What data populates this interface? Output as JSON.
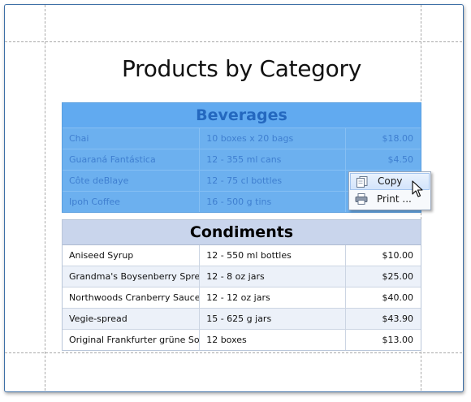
{
  "report": {
    "title": "Products by Category",
    "groups": [
      {
        "name": "Beverages",
        "selected": true,
        "rows": [
          {
            "product": "Chai",
            "quantity": "10 boxes x 20 bags",
            "price": "$18.00"
          },
          {
            "product": "Guaraná Fantástica",
            "quantity": "12 - 355 ml cans",
            "price": "$4.50"
          },
          {
            "product": "Côte deBlaye",
            "quantity": "12 - 75 cl bottles",
            "price": ""
          },
          {
            "product": "Ipoh Coffee",
            "quantity": "16 - 500 g tins",
            "price": ""
          }
        ]
      },
      {
        "name": "Condiments",
        "selected": false,
        "rows": [
          {
            "product": "Aniseed Syrup",
            "quantity": "12 - 550 ml bottles",
            "price": "$10.00"
          },
          {
            "product": "Grandma's Boysenberry Spread",
            "quantity": "12 - 8 oz jars",
            "price": "$25.00"
          },
          {
            "product": "Northwoods Cranberry Sauce",
            "quantity": "12 - 12 oz jars",
            "price": "$40.00"
          },
          {
            "product": "Vegie-spread",
            "quantity": "15 - 625 g jars",
            "price": "$43.90"
          },
          {
            "product": "Original Frankfurter grüne Soße",
            "quantity": "12 boxes",
            "price": "$13.00"
          }
        ]
      }
    ]
  },
  "context_menu": {
    "items": [
      {
        "label": "Copy",
        "icon": "copy-icon",
        "hover": true
      },
      {
        "label": "Print ...",
        "icon": "printer-icon",
        "hover": false
      }
    ]
  },
  "colors": {
    "selection": "#6cb0ef",
    "group_header": "#c9d5ec",
    "frame_border": "#3d6fa6"
  }
}
